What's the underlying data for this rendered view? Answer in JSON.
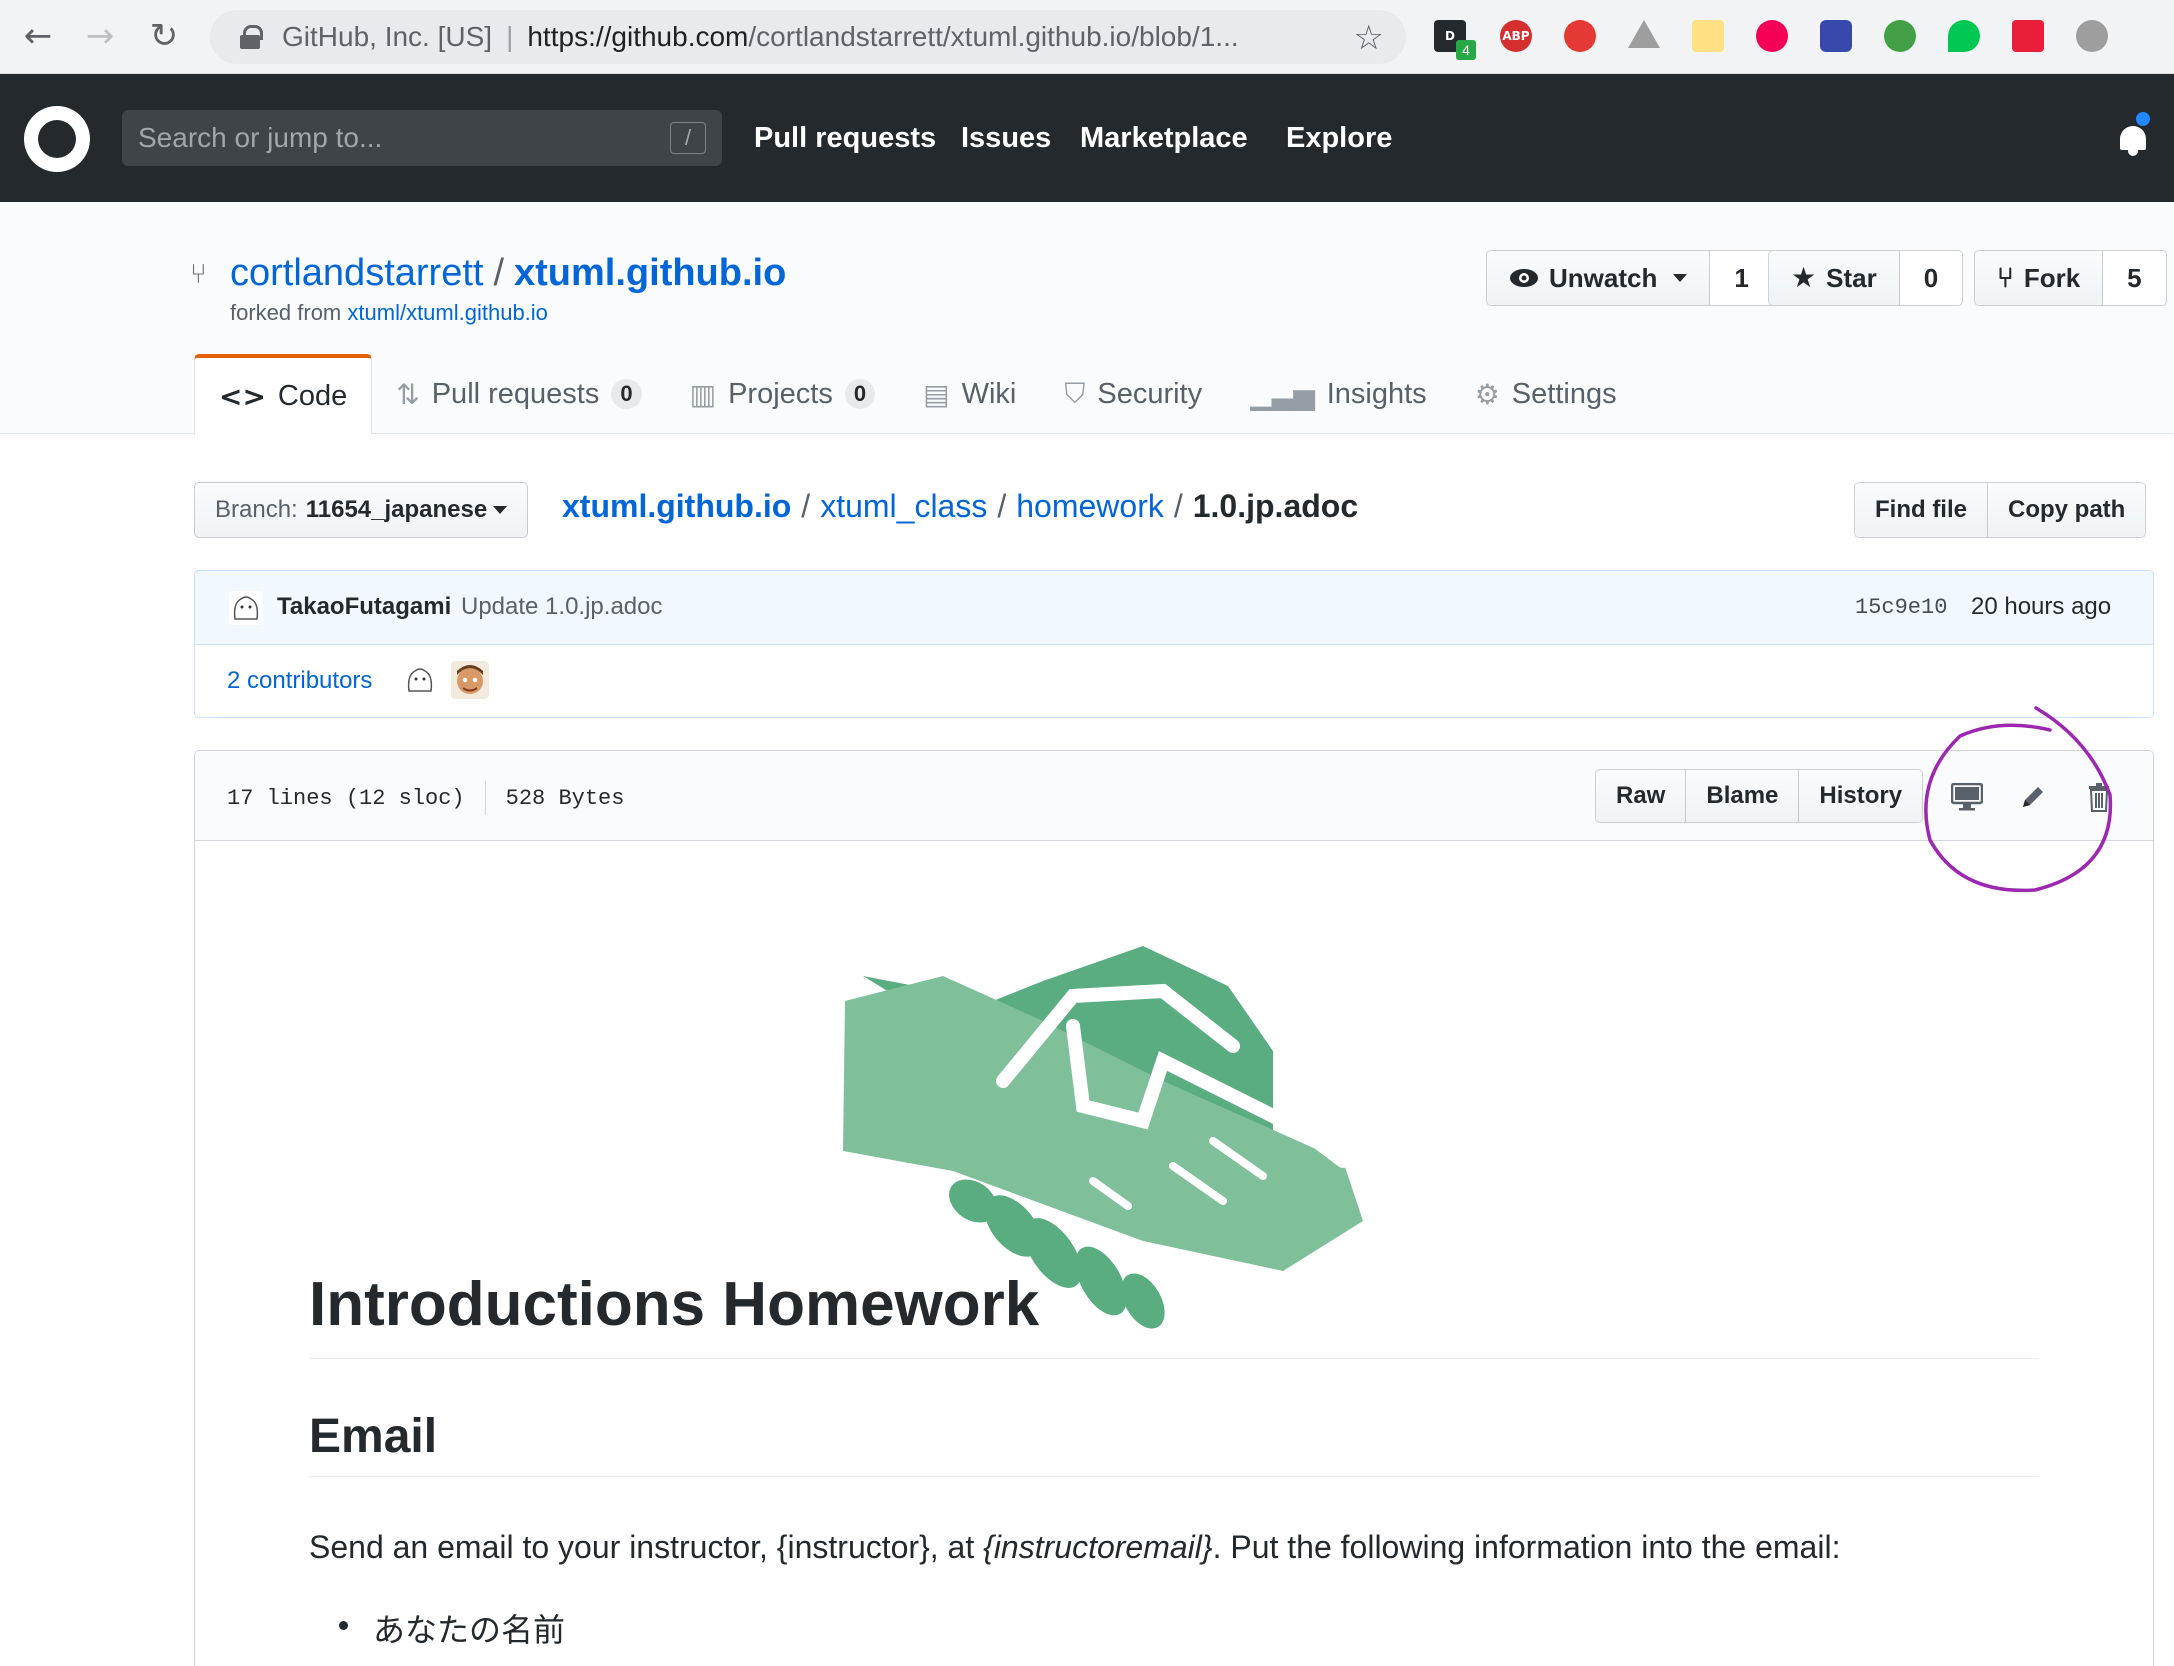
{
  "browser": {
    "org": "GitHub, Inc. [US]",
    "url_host": "https://github.com",
    "url_rest": "/cortlandstarrett/xtuml.github.io/blob/1...",
    "ext_badge": "4",
    "ext_abp": "ABP"
  },
  "header": {
    "search_placeholder": "Search or jump to...",
    "search_shortcut": "/",
    "nav": [
      "Pull requests",
      "Issues",
      "Marketplace",
      "Explore"
    ]
  },
  "repo": {
    "owner": "cortlandstarrett",
    "separator": "/",
    "name": "xtuml.github.io",
    "forked_label": "forked from",
    "forked_from": "xtuml/xtuml.github.io",
    "watch_label": "Unwatch",
    "watch_count": "1",
    "star_label": "Star",
    "star_count": "0",
    "fork_label": "Fork",
    "fork_count": "5"
  },
  "tabs": [
    {
      "label": "Code",
      "icon": "code-icon"
    },
    {
      "label": "Pull requests",
      "count": "0",
      "icon": "pull-request-icon"
    },
    {
      "label": "Projects",
      "count": "0",
      "icon": "project-icon"
    },
    {
      "label": "Wiki",
      "icon": "book-icon"
    },
    {
      "label": "Security",
      "icon": "shield-icon"
    },
    {
      "label": "Insights",
      "icon": "graph-icon"
    },
    {
      "label": "Settings",
      "icon": "gear-icon"
    }
  ],
  "filenav": {
    "branch_label": "Branch:",
    "branch": "11654_japanese",
    "path": [
      "xtuml.github.io",
      "xtuml_class",
      "homework"
    ],
    "path_sep": "/",
    "file": "1.0.jp.adoc",
    "find_file": "Find file",
    "copy_path": "Copy path"
  },
  "commit": {
    "author": "TakaoFutagami",
    "message": "Update 1.0.jp.adoc",
    "sha": "15c9e10",
    "time": "20 hours ago",
    "contributors": "2 contributors"
  },
  "file": {
    "lines": "17 lines (12 sloc)",
    "size": "528 Bytes",
    "raw": "Raw",
    "blame": "Blame",
    "history": "History"
  },
  "content": {
    "h1": "Introductions Homework",
    "h2": "Email",
    "p_before": "Send an email to your instructor, {instructor}, at ",
    "p_em": "{instructoremail}",
    "p_after": ". Put the following information into the email:",
    "li1": "あなたの名前"
  },
  "colors": {
    "header_bg": "#24292e",
    "link": "#0366d6",
    "tab_accent": "#e36209",
    "annotation": "#9c27b0",
    "handshake_dark": "#5aad80",
    "handshake_light": "#7fc09b"
  }
}
